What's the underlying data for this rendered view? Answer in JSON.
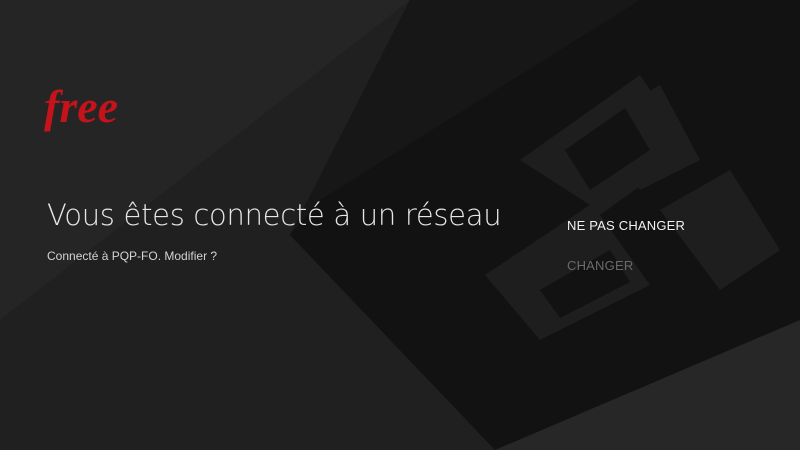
{
  "brand": {
    "logo_text": "free",
    "logo_color": "#c4131b"
  },
  "main": {
    "title": "Vous êtes connecté à un réseau",
    "subtitle": "Connecté à PQP-FO. Modifier ?"
  },
  "menu": {
    "items": [
      {
        "label": "NE PAS CHANGER",
        "state": "focused"
      },
      {
        "label": "CHANGER",
        "state": "unfocused"
      }
    ]
  },
  "colors": {
    "background": "#1f1f1f",
    "accent": "#c4131b",
    "text_primary": "#e6e6e6",
    "text_dim": "#6a6a6a"
  }
}
